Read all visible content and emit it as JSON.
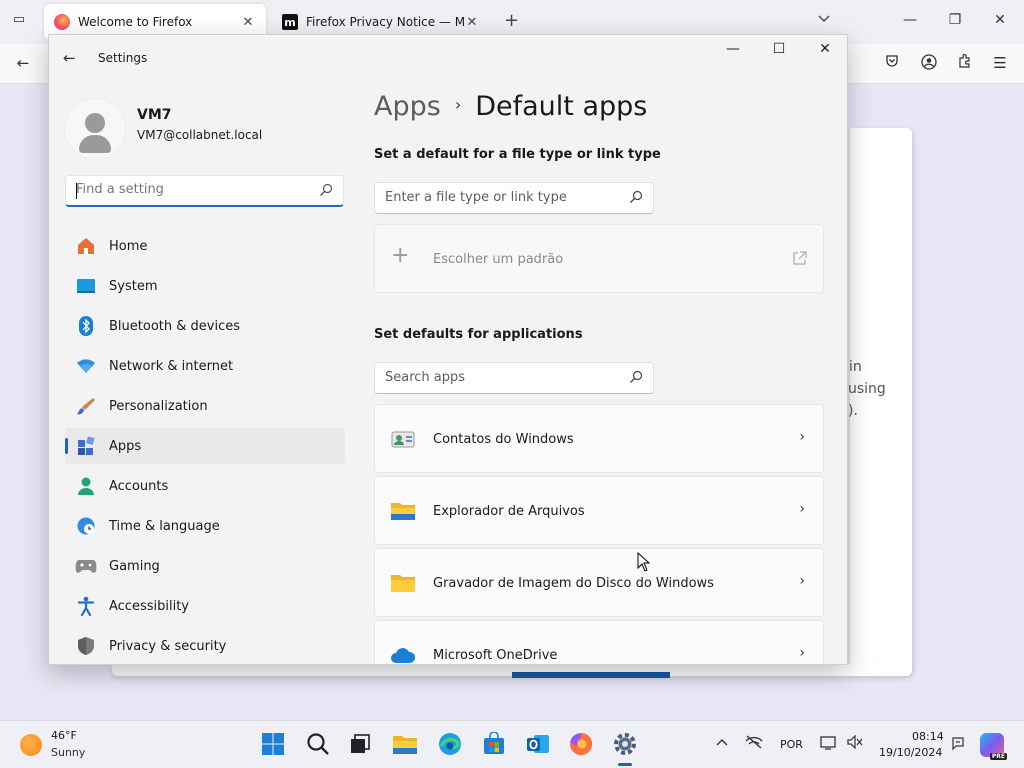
{
  "firefox": {
    "tabs": [
      {
        "title": "Welcome to Firefox",
        "active": true
      },
      {
        "title": "Firefox Privacy Notice — Mozill",
        "active": false
      }
    ],
    "page_fragments": [
      "in",
      "using",
      ")."
    ]
  },
  "settings_window": {
    "title": "Settings",
    "user": {
      "name": "VM7",
      "email": "VM7@collabnet.local"
    },
    "find_setting_placeholder": "Find a setting",
    "nav_items": [
      {
        "label": "Home",
        "icon": "home-icon"
      },
      {
        "label": "System",
        "icon": "system-icon"
      },
      {
        "label": "Bluetooth & devices",
        "icon": "bluetooth-icon"
      },
      {
        "label": "Network & internet",
        "icon": "wifi-icon"
      },
      {
        "label": "Personalization",
        "icon": "brush-icon"
      },
      {
        "label": "Apps",
        "icon": "apps-icon",
        "selected": true
      },
      {
        "label": "Accounts",
        "icon": "person-icon"
      },
      {
        "label": "Time & language",
        "icon": "globe-clock-icon"
      },
      {
        "label": "Gaming",
        "icon": "gamepad-icon"
      },
      {
        "label": "Accessibility",
        "icon": "accessibility-icon"
      },
      {
        "label": "Privacy & security",
        "icon": "shield-icon"
      }
    ],
    "breadcrumb": {
      "parent": "Apps",
      "separator": "›",
      "current": "Default apps"
    },
    "file_type_section": {
      "title": "Set a default for a file type or link type",
      "search_placeholder": "Enter a file type or link type",
      "choose_default_label": "Escolher um padrão"
    },
    "applications_section": {
      "title": "Set defaults for applications",
      "search_placeholder": "Search apps",
      "apps": [
        {
          "name": "Contatos do Windows",
          "icon": "contacts-icon"
        },
        {
          "name": "Explorador de Arquivos",
          "icon": "folder-icon"
        },
        {
          "name": "Gravador de Imagem do Disco do Windows",
          "icon": "folder-icon"
        },
        {
          "name": "Microsoft OneDrive",
          "icon": "cloud-icon"
        }
      ]
    }
  },
  "taskbar": {
    "weather": {
      "temp": "46°F",
      "condition": "Sunny"
    },
    "language": "POR",
    "time": "08:14",
    "date": "19/10/2024",
    "copilot_badge": "PRE"
  },
  "colors": {
    "accent": "#1f5fbf",
    "window_bg": "#f3f3f3"
  }
}
